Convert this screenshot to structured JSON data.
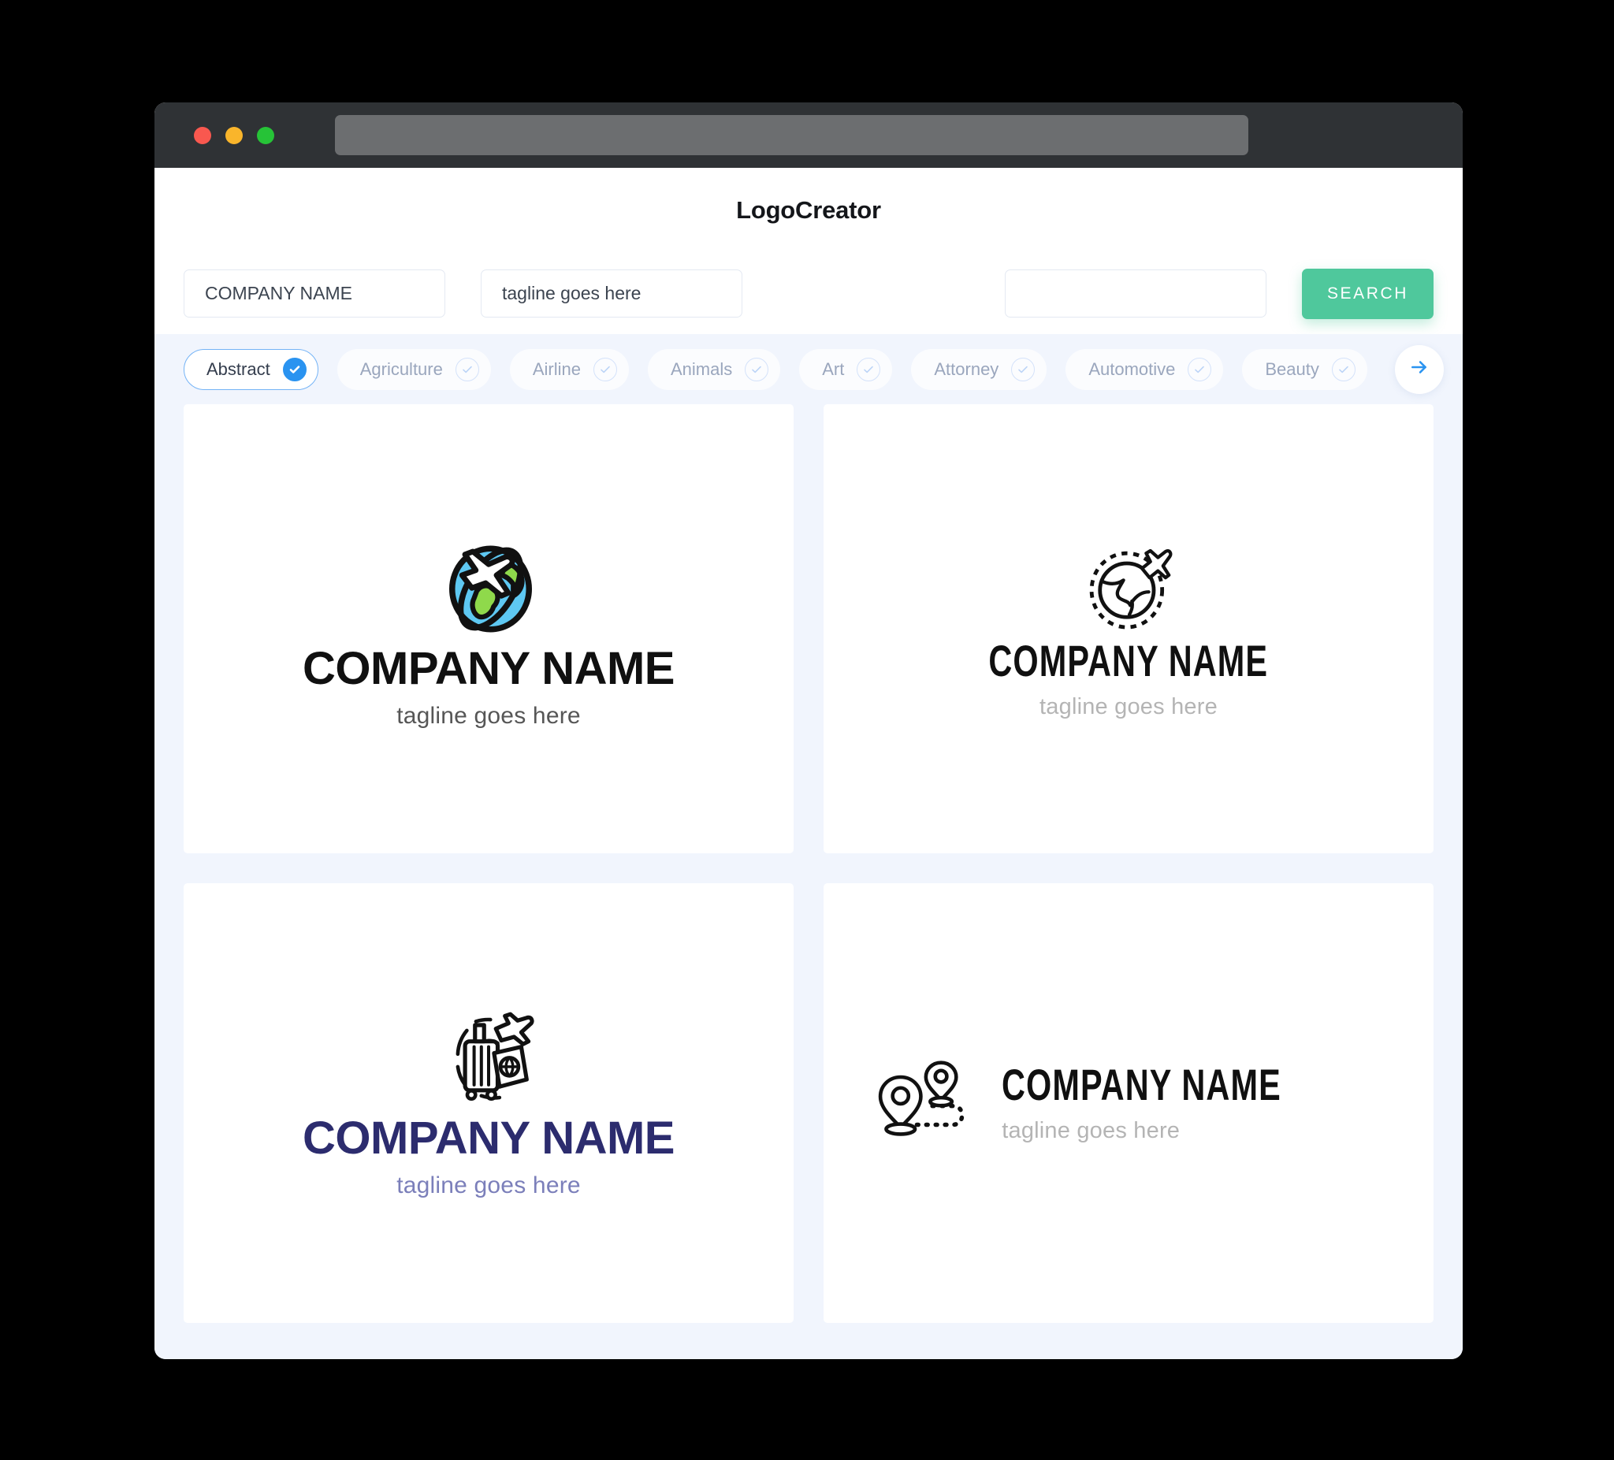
{
  "browser": {
    "traffic_lights": [
      "close",
      "minimize",
      "maximize"
    ],
    "url_value": ""
  },
  "header": {
    "title": "LogoCreator"
  },
  "search": {
    "company_value": "COMPANY NAME",
    "company_placeholder": "COMPANY NAME",
    "tagline_value": "tagline goes here",
    "tagline_placeholder": "tagline goes here",
    "keyword_value": "",
    "keyword_placeholder": "",
    "search_label": "SEARCH",
    "accent_color": "#4fc89c"
  },
  "categories": {
    "next_icon": "arrow-right-icon",
    "accent_color": "#2a93f0",
    "items": [
      {
        "label": "Abstract",
        "selected": true
      },
      {
        "label": "Agriculture",
        "selected": false
      },
      {
        "label": "Airline",
        "selected": false
      },
      {
        "label": "Animals",
        "selected": false
      },
      {
        "label": "Art",
        "selected": false
      },
      {
        "label": "Attorney",
        "selected": false
      },
      {
        "label": "Automotive",
        "selected": false
      },
      {
        "label": "Beauty",
        "selected": false
      }
    ]
  },
  "results": [
    {
      "icon": "globe-airplane-color-icon",
      "name": "COMPANY NAME",
      "tagline": "tagline goes here",
      "name_color": "#101010",
      "tagline_color": "#565656",
      "layout": "stacked"
    },
    {
      "icon": "globe-dashed-orbit-airplane-icon",
      "name": "COMPANY NAME",
      "tagline": "tagline goes here",
      "name_color": "#101010",
      "tagline_color": "#b4b4b4",
      "layout": "stacked"
    },
    {
      "icon": "suitcase-passport-airplane-icon",
      "name": "COMPANY NAME",
      "tagline": "tagline goes here",
      "name_color": "#2c2c6e",
      "tagline_color": "#7b7fba",
      "layout": "stacked"
    },
    {
      "icon": "map-pins-route-icon",
      "name": "COMPANY NAME",
      "tagline": "tagline goes here",
      "name_color": "#101010",
      "tagline_color": "#b4b4b4",
      "layout": "horizontal"
    }
  ]
}
